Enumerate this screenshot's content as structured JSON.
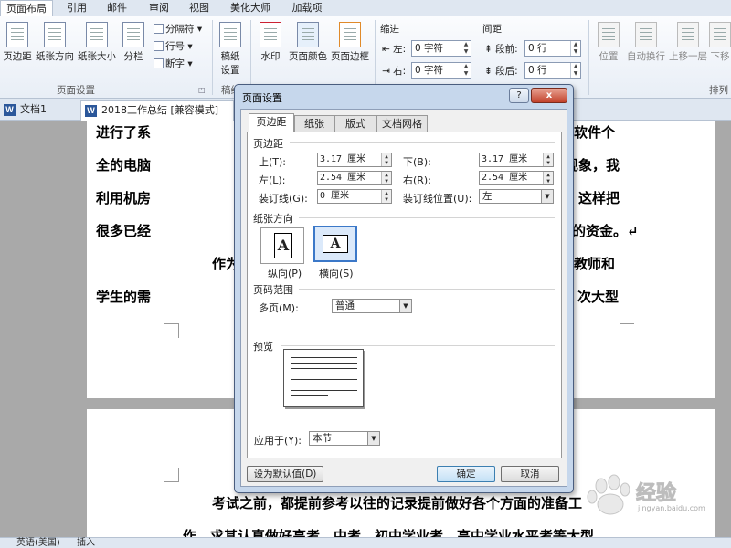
{
  "ribbon": {
    "tabs": [
      {
        "label": "页面布局",
        "active": true
      },
      {
        "label": "引用"
      },
      {
        "label": "邮件"
      },
      {
        "label": "审阅"
      },
      {
        "label": "视图"
      },
      {
        "label": "美化大师"
      },
      {
        "label": "加载项"
      }
    ],
    "page_setup_group": {
      "label": "页面设置",
      "margins": "页边距",
      "orientation": "纸张方向",
      "size": "纸张大小",
      "columns": "分栏",
      "breaks": "分隔符",
      "line_numbers": "行号",
      "hyphenation": "断字"
    },
    "manuscript_group": {
      "label": "稿纸",
      "manuscript_setup_line1": "稿纸",
      "manuscript_setup_line2": "设置"
    },
    "background_group": {
      "watermark": "水印",
      "page_color": "页面颜色",
      "page_borders": "页面边框"
    },
    "paragraph_group": {
      "indent_label": "缩进",
      "indent_left_label": "左:",
      "indent_left_value": "0 字符",
      "indent_right_label": "右:",
      "indent_right_value": "0 字符",
      "spacing_label": "间距",
      "spacing_before_label": "段前:",
      "spacing_before_value": "0 行",
      "spacing_after_label": "段后:",
      "spacing_after_value": "0 行"
    },
    "arrange_group": {
      "label": "排列",
      "position": "位置",
      "wrap_text": "自动换行",
      "bring_forward": "上移一层",
      "send_backward": "下移"
    }
  },
  "document_tabs": [
    {
      "label": "文档1"
    },
    {
      "label": "2018工作总结 [兼容模式]",
      "active": true
    }
  ],
  "document": {
    "page1_lines": [
      "进行了系",
      "全的电脑",
      "利用机房",
      "很多已经",
      "作为",
      "学生的需"
    ],
    "page1_right_fragments": [
      "软件个",
      "现象，我",
      "。这样把",
      "的资金。↵",
      "教师和",
      "次大型"
    ],
    "page2_lines": [
      "考试之前，都提前参考以往的记录提前做好各个方面的准备工",
      "作，求其认真做好高考、中考、初中学业考、高中学业水平考等大型"
    ]
  },
  "status_bar": {
    "language": "英语(美国)",
    "mode": "插入"
  },
  "dialog": {
    "title": "页面设置",
    "help_button": "?",
    "close_button": "x",
    "tabs": [
      "页边距",
      "纸张",
      "版式",
      "文档网格"
    ],
    "margins_section": "页边距",
    "top_label": "上(T):",
    "top_value": "3.17 厘米",
    "bottom_label": "下(B):",
    "bottom_value": "3.17 厘米",
    "left_label": "左(L):",
    "left_value": "2.54 厘米",
    "right_label": "右(R):",
    "right_value": "2.54 厘米",
    "gutter_label": "装订线(G):",
    "gutter_value": "0 厘米",
    "gutter_pos_label": "装订线位置(U):",
    "gutter_pos_value": "左",
    "orientation_section": "纸张方向",
    "portrait_label": "纵向(P)",
    "landscape_label": "横向(S)",
    "orient_glyph": "A",
    "pages_section": "页码范围",
    "multiple_pages_label": "多页(M):",
    "multiple_pages_value": "普通",
    "preview_section": "预览",
    "apply_to_label": "应用于(Y):",
    "apply_to_value": "本节",
    "set_default_button": "设为默认值(D)",
    "ok_button": "确定",
    "cancel_button": "取消"
  },
  "watermark": {
    "text": "经验",
    "subtext": "jingyan.baidu.com"
  }
}
